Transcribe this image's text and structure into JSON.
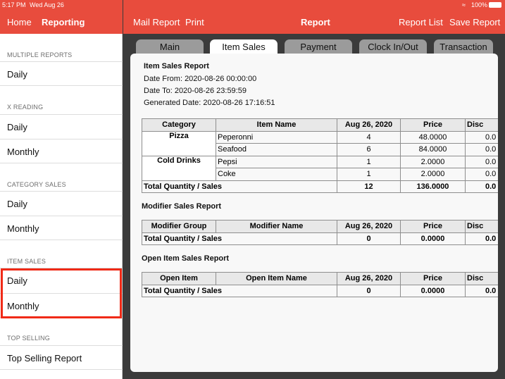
{
  "status": {
    "time": "5:17 PM",
    "date": "Wed Aug 26",
    "battery": "100%",
    "wifi_icon": "wifi-icon"
  },
  "left_nav": {
    "home": "Home",
    "reporting": "Reporting"
  },
  "top_nav": {
    "mail": "Mail Report",
    "print": "Print",
    "title": "Report",
    "report_list": "Report List",
    "save": "Save Report"
  },
  "sidebar": {
    "s1": "MULTIPLE REPORTS",
    "s1_daily": "Daily",
    "s2": "X READING",
    "s2_daily": "Daily",
    "s2_monthly": "Monthly",
    "s3": "CATEGORY SALES",
    "s3_daily": "Daily",
    "s3_monthly": "Monthly",
    "s4": "ITEM SALES",
    "s4_daily": "Daily",
    "s4_monthly": "Monthly",
    "s5": "TOP SELLING",
    "s5_report": "Top Selling Report"
  },
  "tabs": [
    "Main",
    "Item Sales",
    "Payment",
    "Clock In/Out",
    "Transaction"
  ],
  "report": {
    "title": "Item Sales Report",
    "from": "Date From: 2020-08-26 00:00:00",
    "to": "Date To: 2020-08-26 23:59:59",
    "generated": "Generated Date: 2020-08-26 17:16:51",
    "item_headers": [
      "Category",
      "Item Name",
      "Aug 26, 2020",
      "Price",
      "Disc"
    ],
    "items": [
      {
        "category": "Pizza",
        "name": "Peperonni",
        "qty": "4",
        "price": "48.0000",
        "disc": "0.0"
      },
      {
        "category": "",
        "name": "Seafood",
        "qty": "6",
        "price": "84.0000",
        "disc": "0.0"
      },
      {
        "category": "Cold Drinks",
        "name": "Pepsi",
        "qty": "1",
        "price": "2.0000",
        "disc": "0.0"
      },
      {
        "category": "",
        "name": "Coke",
        "qty": "1",
        "price": "2.0000",
        "disc": "0.0"
      }
    ],
    "item_total": {
      "label": "Total Quantity / Sales",
      "qty": "12",
      "price": "136.0000",
      "disc": "0.0"
    },
    "modifier_title": "Modifier Sales Report",
    "modifier_headers": [
      "Modifier Group",
      "Modifier Name",
      "Aug 26, 2020",
      "Price",
      "Disc"
    ],
    "modifier_total": {
      "label": "Total Quantity / Sales",
      "qty": "0",
      "price": "0.0000",
      "disc": "0.0"
    },
    "open_title": "Open Item Sales Report",
    "open_headers": [
      "Open Item",
      "Open Item Name",
      "Aug 26, 2020",
      "Price",
      "Disc"
    ],
    "open_total": {
      "label": "Total Quantity / Sales",
      "qty": "0",
      "price": "0.0000",
      "disc": "0.0"
    }
  }
}
